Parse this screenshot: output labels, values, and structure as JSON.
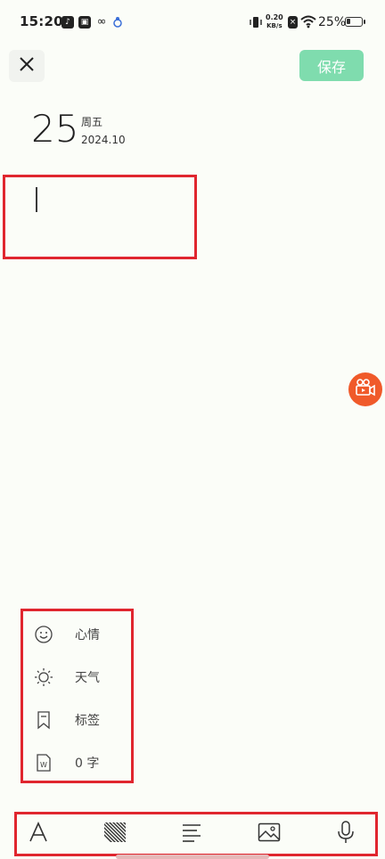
{
  "status_bar": {
    "time": "15:20",
    "net_speed_value": "0.20",
    "net_speed_unit": "KB/s",
    "battery_text": "25%",
    "battery_level": 0.25,
    "icons": [
      "tiktok-icon",
      "inbox-icon",
      "link-icon",
      "bug-icon",
      "vibrate-icon",
      "sim-icon",
      "wifi-icon",
      "battery-icon"
    ]
  },
  "top_bar": {
    "close_icon": "close-icon",
    "save_label": "保存"
  },
  "date": {
    "day": "25",
    "weekday": "周五",
    "year_month": "2024.10"
  },
  "editor": {
    "text": ""
  },
  "meta": {
    "items": [
      {
        "icon": "smile-icon",
        "label": "心情"
      },
      {
        "icon": "sun-icon",
        "label": "天气"
      },
      {
        "icon": "bookmark-icon",
        "label": "标签"
      },
      {
        "icon": "word-doc-icon",
        "label": "0 字"
      }
    ]
  },
  "toolbar": {
    "items": [
      "text-style-icon",
      "hatch-pattern-icon",
      "align-left-icon",
      "image-icon",
      "microphone-icon"
    ]
  },
  "colors": {
    "accent": "#7fdcae",
    "highlight_border": "#e0262f",
    "float_button": "#f05a2a",
    "background": "#fbfdf8"
  }
}
